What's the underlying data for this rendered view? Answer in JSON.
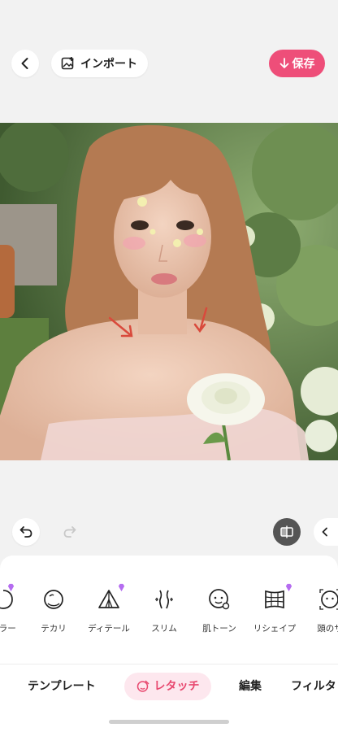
{
  "header": {
    "import_label": "インポート",
    "save_label": "保存"
  },
  "photo": {
    "description_colors": {
      "skin": "#e9c4ae",
      "hair": "#b9784f",
      "foliage": "#5d7a4a"
    }
  },
  "tools": [
    {
      "label": "ーラー",
      "icon": "face-outline-icon",
      "premium": true
    },
    {
      "label": "テカリ",
      "icon": "face-icon",
      "premium": false
    },
    {
      "label": "ディテール",
      "icon": "detail-triangle-icon",
      "premium": true
    },
    {
      "label": "スリム",
      "icon": "body-slim-icon",
      "premium": false
    },
    {
      "label": "肌トーン",
      "icon": "face-tone-icon",
      "premium": false
    },
    {
      "label": "リシェイプ",
      "icon": "grid-reshape-icon",
      "premium": true
    },
    {
      "label": "頭のサ",
      "icon": "head-size-icon",
      "premium": false
    }
  ],
  "tabs": [
    {
      "label": "テンプレート"
    },
    {
      "label": "レタッチ",
      "active": true
    },
    {
      "label": "編集"
    },
    {
      "label": "フィルタ"
    }
  ],
  "colors": {
    "accent": "#ee4e79",
    "accent_bg": "#fde7ee",
    "gem": "#b56cf0"
  }
}
